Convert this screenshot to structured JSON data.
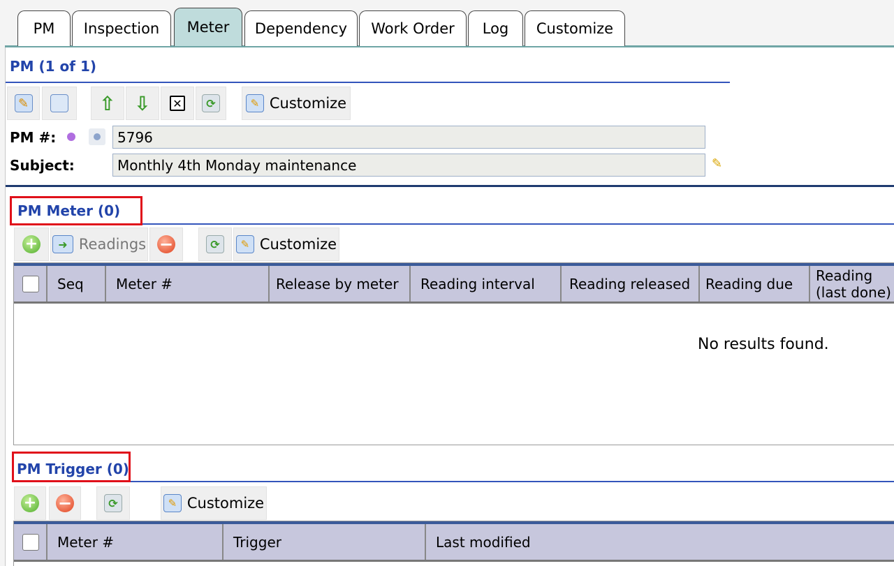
{
  "tabs": [
    {
      "label": "PM"
    },
    {
      "label": "Inspection"
    },
    {
      "label": "Meter"
    },
    {
      "label": "Dependency"
    },
    {
      "label": "Work Order"
    },
    {
      "label": "Log"
    },
    {
      "label": "Customize"
    }
  ],
  "pm": {
    "title": "PM (1 of 1)",
    "toolbar": {
      "customize_label": "Customize"
    },
    "pm_number_label": "PM #:",
    "pm_number_value": "5796",
    "subject_label": "Subject:",
    "subject_value": "Monthly 4th Monday maintenance"
  },
  "meter": {
    "title": "PM Meter (0)",
    "toolbar": {
      "readings_label": "Readings",
      "customize_label": "Customize"
    },
    "columns": [
      "Seq",
      "Meter #",
      "Release by meter",
      "Reading interval",
      "Reading released",
      "Reading due",
      "Reading (last done)"
    ],
    "empty_text": "No results found."
  },
  "trigger": {
    "title": "PM Trigger (0)",
    "toolbar": {
      "customize_label": "Customize"
    },
    "columns": [
      "Meter #",
      "Trigger",
      "Last modified"
    ]
  },
  "colors": {
    "accent_blue": "#2244aa",
    "highlight_red": "#e0101a",
    "active_tab": "#bfdcdc",
    "grid_header": "#c7c7dd"
  }
}
